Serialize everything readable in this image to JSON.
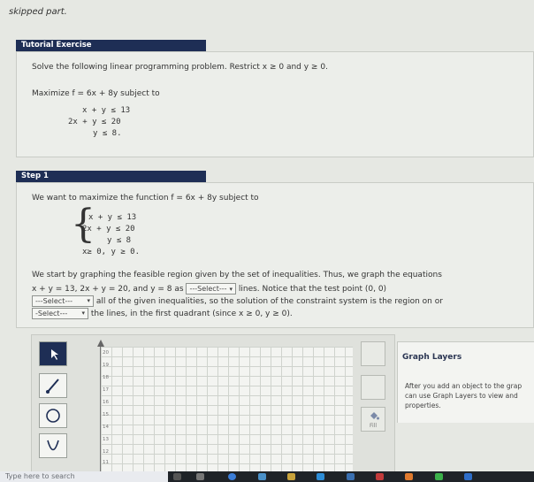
{
  "top_note": "skipped part.",
  "tutorial": {
    "header": "Tutorial Exercise",
    "instruction": "Solve the following linear programming problem. Restrict x ≥ 0 and y ≥ 0.",
    "maximize": "Maximize f = 6x + 8y subject to",
    "constraints": [
      "x + y ≤ 13",
      "2x + y ≤ 20",
      "y ≤ 8."
    ]
  },
  "step": {
    "header": "Step 1",
    "intro": "We want to maximize the function f = 6x + 8y subject to",
    "system": [
      "x + y ≤ 13",
      "2x + y ≤ 20",
      "y ≤ 8",
      "x≥ 0, y ≥ 0."
    ],
    "para1": "We start by graphing the feasible region given by the set of inequalities. Thus, we graph the equations",
    "para2_a": "x + y = 13,  2x + y = 20,  and  y = 8  as",
    "para2_b": "lines. Notice that the test point  (0, 0)",
    "para3": "all of the given inequalities, so the solution of the constraint system is the region on or",
    "para4": "the lines, in the first quadrant (since  x ≥ 0,  y ≥ 0).",
    "select_label": "---Select---",
    "select_label_2": "-Select---"
  },
  "graph": {
    "y_ticks": [
      "20",
      "19",
      "18",
      "17",
      "16",
      "15",
      "14",
      "13",
      "12",
      "11"
    ],
    "fill_label": "Fill"
  },
  "layers": {
    "title": "Graph Layers",
    "text": [
      "After you add an object to the grap",
      "can use Graph Layers to view and",
      "properties."
    ]
  },
  "taskbar": {
    "search_placeholder": "Type here to search"
  }
}
